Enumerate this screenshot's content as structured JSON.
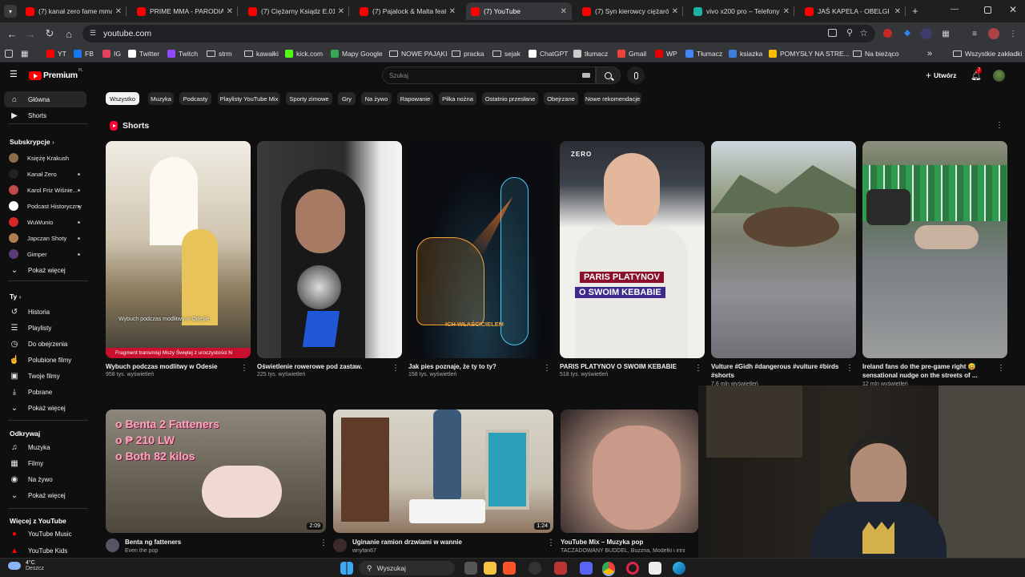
{
  "browser": {
    "tabs": [
      {
        "label": "(7) kanał zero fame mma",
        "color": "#ff0000"
      },
      {
        "label": "PRIME MMA - PARODIA",
        "color": "#ff0000"
      },
      {
        "label": "(7) Ciężarny Ksiądz E.01.",
        "color": "#ff0000"
      },
      {
        "label": "(7) Pajalock & Malta feat.",
        "color": "#ff0000"
      },
      {
        "label": "(7) YouTube",
        "color": "#ff0000"
      },
      {
        "label": "(7) Syn kierowcy ciężarów",
        "color": "#ff0000"
      },
      {
        "label": "vivo x200 pro – Telefony",
        "color": "#19b2a4"
      },
      {
        "label": "JAŚ KAPELA - OBELGI I BL",
        "color": "#ff0000"
      }
    ],
    "new_tab_symbol": "+",
    "address": "youtube.com",
    "bookmarks": [
      {
        "label": "YT",
        "color": "#ff0000"
      },
      {
        "label": "FB",
        "color": "#1877f2"
      },
      {
        "label": "IG",
        "color": "#e4405f"
      },
      {
        "label": "Twitter",
        "color": "#ffffff"
      },
      {
        "label": "Twitch",
        "color": "#9146ff"
      },
      {
        "label": "strm",
        "color": "folder"
      },
      {
        "label": "kawałki",
        "color": "folder"
      },
      {
        "label": "kick.com",
        "color": "#53fc18"
      },
      {
        "label": "Mapy Google",
        "color": "#34a853"
      },
      {
        "label": "NOWE PAJĄKI",
        "color": "folder"
      },
      {
        "label": "pracka",
        "color": "folder"
      },
      {
        "label": "sejak",
        "color": "folder"
      },
      {
        "label": "ChatGPT",
        "color": "#ffffff"
      },
      {
        "label": "tłumacz",
        "color": "#cccccc"
      },
      {
        "label": "Gmail",
        "color": "#ea4335"
      },
      {
        "label": "WP",
        "color": "#e60000"
      },
      {
        "label": "Tłumacz",
        "color": "#4285f4"
      },
      {
        "label": "ksiazka",
        "color": "#3b7dd8"
      },
      {
        "label": "POMYSŁY NA STRE...",
        "color": "#fbbc04"
      },
      {
        "label": "Na bieżąco",
        "color": "folder"
      }
    ],
    "bookmarks_more": "»",
    "all_bookmarks": "Wszystkie zakładki"
  },
  "youtube": {
    "logo_text": "Premium",
    "logo_region": "PL",
    "search_placeholder": "Szukaj",
    "create_label": "Utwórz",
    "notif_count": "7",
    "chips": [
      "Wszystko",
      "Muzyka",
      "Podcasty",
      "Playlisty YouTube Mix",
      "Sporty zimowe",
      "Gry",
      "Na żywo",
      "Rapowanie",
      "Piłka nożna",
      "Ostatnio przesłane",
      "Obejrzane",
      "Nowe rekomendacje"
    ],
    "sidebar": {
      "main": [
        {
          "label": "Główna",
          "icon": "home-icon"
        },
        {
          "label": "Shorts",
          "icon": "shorts-icon"
        }
      ],
      "subs_header": "Subskrypcje",
      "subs": [
        {
          "label": "Księżę Krakush",
          "color": "#8a6d4a"
        },
        {
          "label": "Kanał Zero",
          "color": "#222222"
        },
        {
          "label": "Karol Friz Wiśnie...",
          "color": "#c04a4a"
        },
        {
          "label": "Podcast Historyczny",
          "color": "#ffffff"
        },
        {
          "label": "WuWunio",
          "color": "#d62828"
        },
        {
          "label": "Japczan Shoty",
          "color": "#b08050"
        },
        {
          "label": "Gimper",
          "color": "#5a3a7a"
        }
      ],
      "show_more": "Pokaż więcej",
      "you_header": "Ty",
      "you": [
        {
          "label": "Historia",
          "icon": "history-icon"
        },
        {
          "label": "Playlisty",
          "icon": "playlist-icon"
        },
        {
          "label": "Do obejrzenia",
          "icon": "clock-icon"
        },
        {
          "label": "Polubione filmy",
          "icon": "like-icon"
        },
        {
          "label": "Twoje filmy",
          "icon": "video-icon"
        },
        {
          "label": "Pobrane",
          "icon": "download-icon"
        },
        {
          "label": "Pokaż więcej",
          "icon": "chevron-down-icon"
        }
      ],
      "explore_header": "Odkrywaj",
      "explore": [
        {
          "label": "Muzyka",
          "icon": "music-icon"
        },
        {
          "label": "Filmy",
          "icon": "film-icon"
        },
        {
          "label": "Na żywo",
          "icon": "live-icon"
        },
        {
          "label": "Pokaż więcej",
          "icon": "chevron-down-icon"
        }
      ],
      "more_header": "Więcej z YouTube",
      "more": [
        {
          "label": "YouTube Music",
          "icon": "yt-music-icon"
        },
        {
          "label": "YouTube Kids",
          "icon": "yt-kids-icon"
        }
      ]
    },
    "shorts_header": "Shorts",
    "shorts": [
      {
        "title": "Wybuch podczas modlitwy w Odesie",
        "views": "958 tys. wyświetleń",
        "overlay": "Wybuch podczas modlitwy w Odesie",
        "banner": "Fragment transmisji Mszy Świętej z uroczystości N",
        "bg": "#b9ad96"
      },
      {
        "title": "Oświetlenie rowerowe pod zastaw.",
        "views": "225 tys. wyświetleń",
        "bg": "#4a4a4a"
      },
      {
        "title": "Jak pies poznaje, że ty to ty?",
        "views": "158 tys. wyświetleń",
        "overlay": "ICH WŁAŚCICIELEM",
        "bg": "#0a0c12"
      },
      {
        "title": "PARIS PLATYNOV O SWOIM KEBABIE",
        "views": "518 tys. wyświetleń",
        "overlay_1": "PARIS PLATYNOV",
        "overlay_2": "O SWOIM KEBABIE",
        "brand": "ZERO",
        "bg": "#e9e7e3"
      },
      {
        "title": "Vulture #Gidh #dangerous #vulture #birds #shorts",
        "views": "7,6 mln wyświetleń",
        "bg": "#7d8872"
      },
      {
        "title": "Ireland fans do the pre-game right 😅 sensational nudge on the streets of ...",
        "views": "12 mln wyświetleń",
        "bg": "#6f7a6d"
      }
    ],
    "videos": [
      {
        "title": "Benta ng fatteners",
        "channel": "Even the pop",
        "duration": "2:09",
        "lines": [
          "o  Benta 2 Fatteners",
          "o  ₱ 210  LW",
          "o  Both 82 kilos"
        ]
      },
      {
        "title": "Uginanie ramion drzwiami w wannie",
        "channel": "wnyfan67",
        "duration": "1:24"
      },
      {
        "title": "YouTube Mix – Muzyka pop",
        "channel": "TACZADOWANY BUDDEL, Buzzna, Modelki i inni"
      }
    ]
  },
  "taskbar": {
    "weather_temp": "4°C",
    "weather_desc": "Deszcz",
    "search_label": "Wyszukaj"
  }
}
